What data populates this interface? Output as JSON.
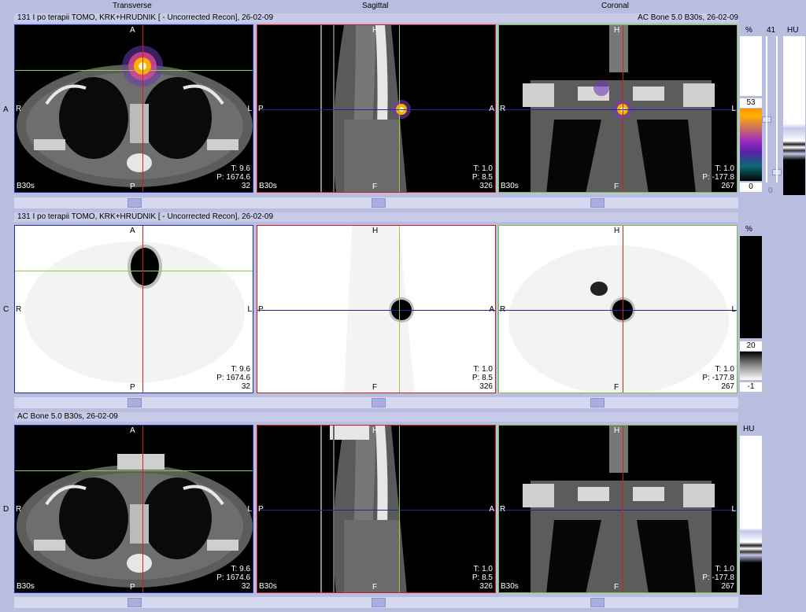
{
  "views": {
    "transverse": "Transverse",
    "sagittal": "Sagittal",
    "coronal": "Coronal"
  },
  "rows": {
    "A": {
      "label": "A",
      "info": "131 I po terapii TOMO, KRK+HRUDNIK [ - Uncorrected Recon], 26-02-09",
      "info_right": "AC  Bone  5.0  B30s, 26-02-09"
    },
    "C": {
      "label": "C",
      "info": "131 I po terapii TOMO, KRK+HRUDNIK [ - Uncorrected Recon], 26-02-09"
    },
    "D": {
      "label": "D",
      "info": "AC  Bone  5.0  B30s, 26-02-09"
    }
  },
  "orient": {
    "transverse": {
      "top": "A",
      "bottom": "P",
      "left": "R",
      "right": "L"
    },
    "sagittal": {
      "top": "H",
      "bottom": "F",
      "left": "P",
      "right": "A"
    },
    "coronal": {
      "top": "H",
      "bottom": "F",
      "left": "R",
      "right": "L"
    }
  },
  "slice_info": {
    "transverse": {
      "t": "T: 9.6",
      "p": "P: 1674.6",
      "n": "32"
    },
    "sagittal": {
      "t": "T: 1.0",
      "p": "P: 8.5",
      "n": "326"
    },
    "coronal": {
      "t": "T: 1.0",
      "p": "P: -177.8",
      "n": "267"
    }
  },
  "series_label": "B30s",
  "scales": {
    "percent_label": "%",
    "hu_label": "HU",
    "row_a_pct_top": "41",
    "row_a_pct_value": "53",
    "row_a_pct_bottom": "0",
    "row_a_hu_min": "0",
    "row_c_pct_value": "20",
    "row_c_pct_bottom": "-1"
  },
  "colors": {
    "transverse_border": "#1f2fa0",
    "sagittal_border": "#c82020",
    "coronal_border": "#7ac23a",
    "crosshair_green": "#8dcf3a",
    "crosshair_red": "#d02020",
    "crosshair_blue": "#1d2a9c",
    "hot_spot": "#ffb000"
  }
}
